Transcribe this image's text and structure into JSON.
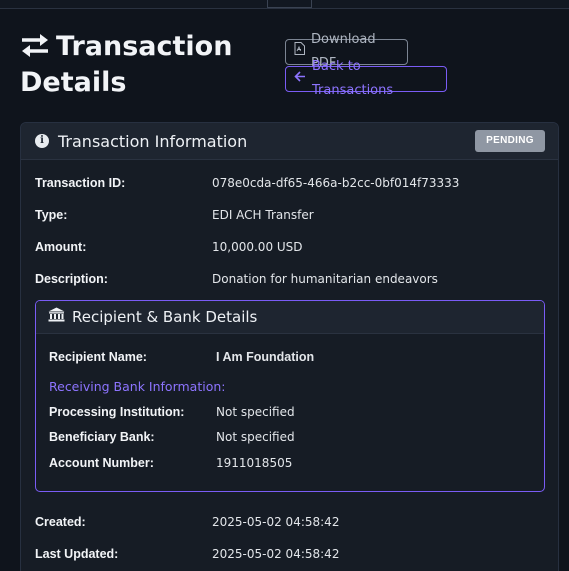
{
  "page": {
    "title_line1": "Transaction",
    "title_line2": "Details",
    "download_pdf": "Download PDF",
    "back": "Back to Transactions"
  },
  "card": {
    "title": "Transaction Information",
    "status": "PENDING",
    "fields": {
      "id_label": "Transaction ID:",
      "id_value": "078e0cda-df65-466a-b2cc-0bf014f73333",
      "type_label": "Type:",
      "type_value": "EDI ACH Transfer",
      "amount_label": "Amount:",
      "amount_value": "10,000.00 USD",
      "desc_label": "Description:",
      "desc_value": "Donation for humanitarian endeavors",
      "created_label": "Created:",
      "created_value": "2025-05-02 04:58:42",
      "updated_label": "Last Updated:",
      "updated_value": "2025-05-02 04:58:42"
    }
  },
  "recipient": {
    "title": "Recipient & Bank Details",
    "name_label": "Recipient Name:",
    "name_value": "I Am Foundation",
    "bank_info_label": "Receiving Bank Information:",
    "processing_label": "Processing Institution:",
    "processing_value": "Not specified",
    "beneficiary_label": "Beneficiary Bank:",
    "beneficiary_value": "Not specified",
    "account_label": "Account Number:",
    "account_value": "1911018505"
  },
  "colors": {
    "background": "#0f141c",
    "accent": "#7a5cf5",
    "pending_badge": "#8f97a3"
  },
  "icons": [
    "swap-arrows-icon",
    "pdf-file-icon",
    "arrow-left-icon",
    "info-icon",
    "bank-icon"
  ]
}
